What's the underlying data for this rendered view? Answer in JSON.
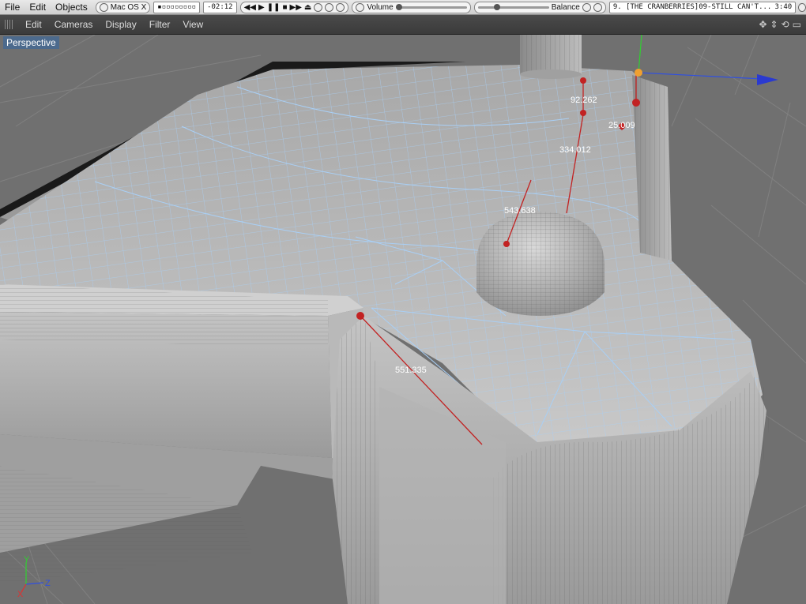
{
  "menubar": {
    "items": [
      "File",
      "Edit",
      "Objects"
    ],
    "player": {
      "source": "Mac OS X",
      "elapsed": "-02:12",
      "volume_label": "Volume",
      "balance_label": "Balance",
      "track": "9. [THE CRANBERRIES]09-STILL CAN'T...",
      "duration": "3:40"
    }
  },
  "viewport_menu": {
    "items": [
      "Edit",
      "Cameras",
      "Display",
      "Filter",
      "View"
    ],
    "icons": [
      "move-view-icon",
      "dolly-view-icon",
      "rotate-view-icon",
      "maximize-view-icon"
    ]
  },
  "viewport": {
    "label": "Perspective",
    "measurements": [
      "92.262",
      "25.009",
      "334.012",
      "543.638",
      "551.335"
    ],
    "axes": {
      "y": "Y",
      "z": "Z",
      "x": "X"
    }
  },
  "colors": {
    "background": "#6f6f6f",
    "mesh_wire": "#a9cff5",
    "active_label": "#4c6a8d",
    "measure_line": "#c22222",
    "axis_x": "#e03030",
    "axis_y": "#30d030",
    "axis_z": "#3050e0"
  }
}
